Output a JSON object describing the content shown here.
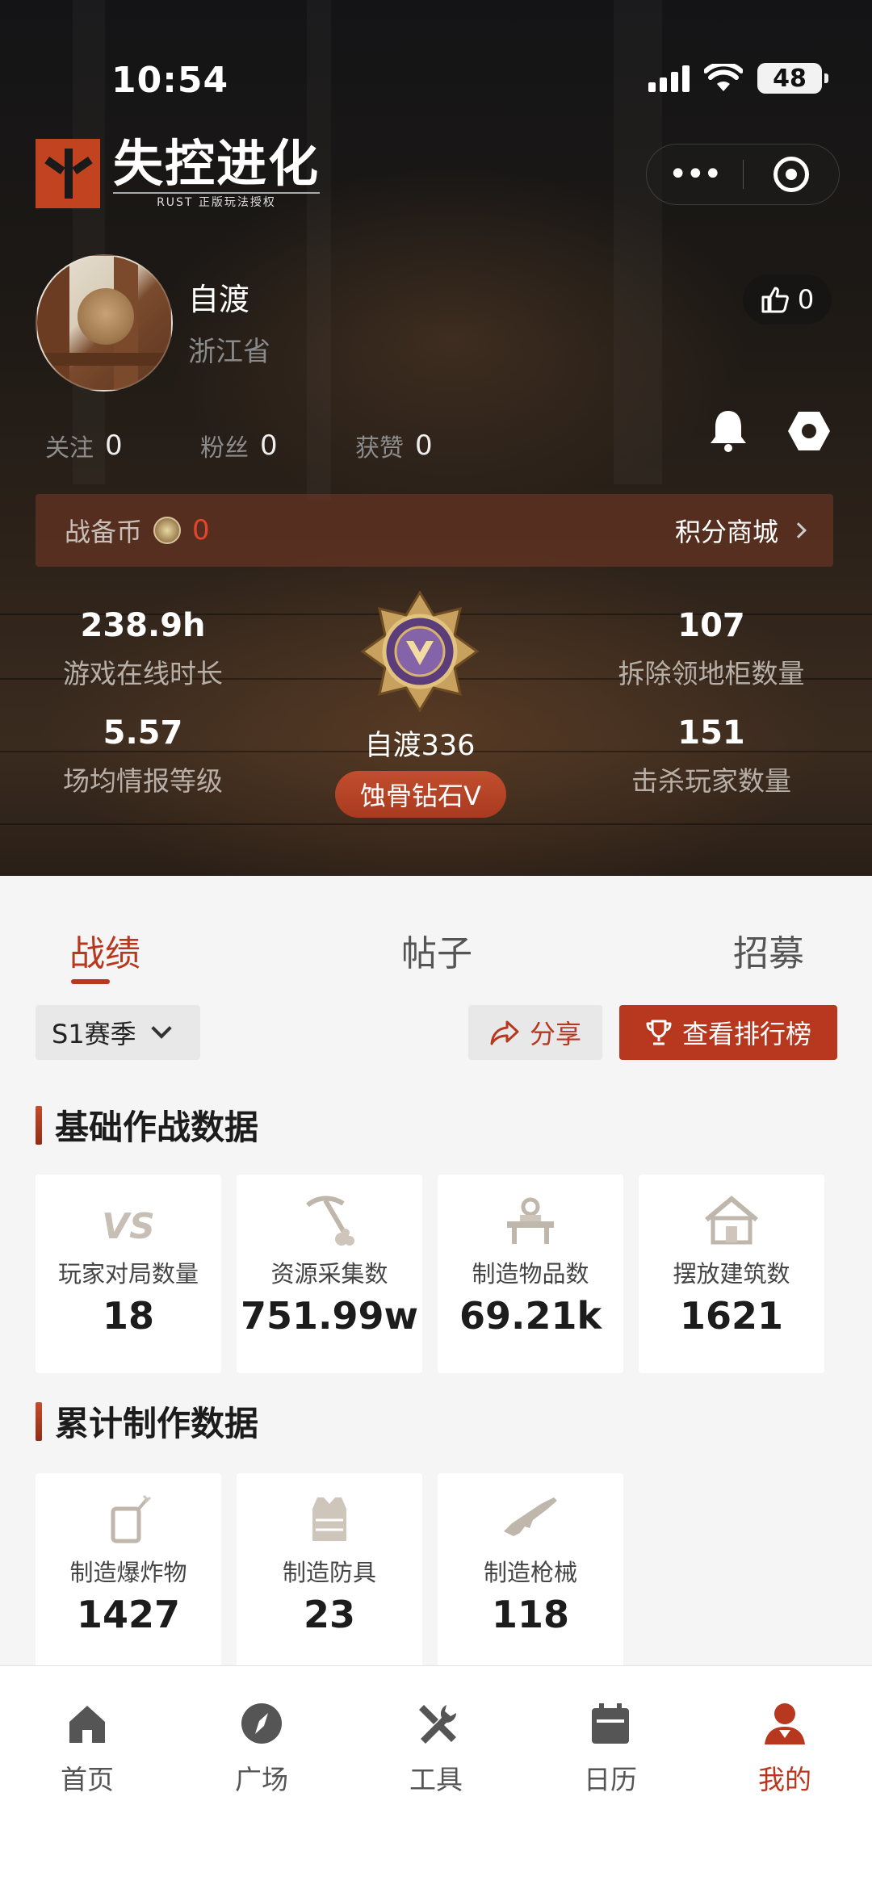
{
  "status_bar": {
    "time": "10:54",
    "battery": "48"
  },
  "header": {
    "logo_title": "失控进化",
    "logo_subtitle": "RUST 正版玩法授权",
    "more_icon": "more-dots-icon",
    "target_icon": "target-icon"
  },
  "profile": {
    "name": "自渡",
    "location": "浙江省",
    "likes": "0",
    "follow_label": "关注",
    "follow_count": "0",
    "fans_label": "粉丝",
    "fans_count": "0",
    "praise_label": "获赞",
    "praise_count": "0"
  },
  "coins": {
    "label": "战备币",
    "value": "0",
    "shop_label": "积分商城"
  },
  "stats": {
    "online_value": "238.9h",
    "online_label": "游戏在线时长",
    "intel_value": "5.57",
    "intel_label": "场均情报等级",
    "cabinet_value": "107",
    "cabinet_label": "拆除领地柜数量",
    "kills_value": "151",
    "kills_label": "击杀玩家数量",
    "player_name": "自渡336",
    "rank": "蚀骨钻石V"
  },
  "tabs": [
    {
      "label": "战绩"
    },
    {
      "label": "帖子"
    },
    {
      "label": "招募"
    }
  ],
  "controls": {
    "season": "S1赛季",
    "share": "分享",
    "leaderboard": "查看排行榜"
  },
  "basic": {
    "title": "基础作战数据",
    "cards": [
      {
        "icon": "vs-icon",
        "label": "玩家对局数量",
        "value": "18"
      },
      {
        "icon": "pickaxe-icon",
        "label": "资源采集数",
        "value": "751.99w"
      },
      {
        "icon": "workbench-icon",
        "label": "制造物品数",
        "value": "69.21k"
      },
      {
        "icon": "house-icon",
        "label": "摆放建筑数",
        "value": "1621"
      }
    ]
  },
  "crafting": {
    "title": "累计制作数据",
    "cards": [
      {
        "icon": "explosive-icon",
        "label": "制造爆炸物",
        "value": "1427"
      },
      {
        "icon": "armor-icon",
        "label": "制造防具",
        "value": "23"
      },
      {
        "icon": "rifle-icon",
        "label": "制造枪械",
        "value": "118"
      }
    ]
  },
  "nav": [
    {
      "label": "首页",
      "icon": "home-icon"
    },
    {
      "label": "广场",
      "icon": "compass-icon"
    },
    {
      "label": "工具",
      "icon": "tools-icon"
    },
    {
      "label": "日历",
      "icon": "calendar-icon"
    },
    {
      "label": "我的",
      "icon": "profile-icon"
    }
  ],
  "colors": {
    "accent": "#b7381f",
    "coin_value": "#e0472a",
    "hero_dark": "#141416"
  }
}
